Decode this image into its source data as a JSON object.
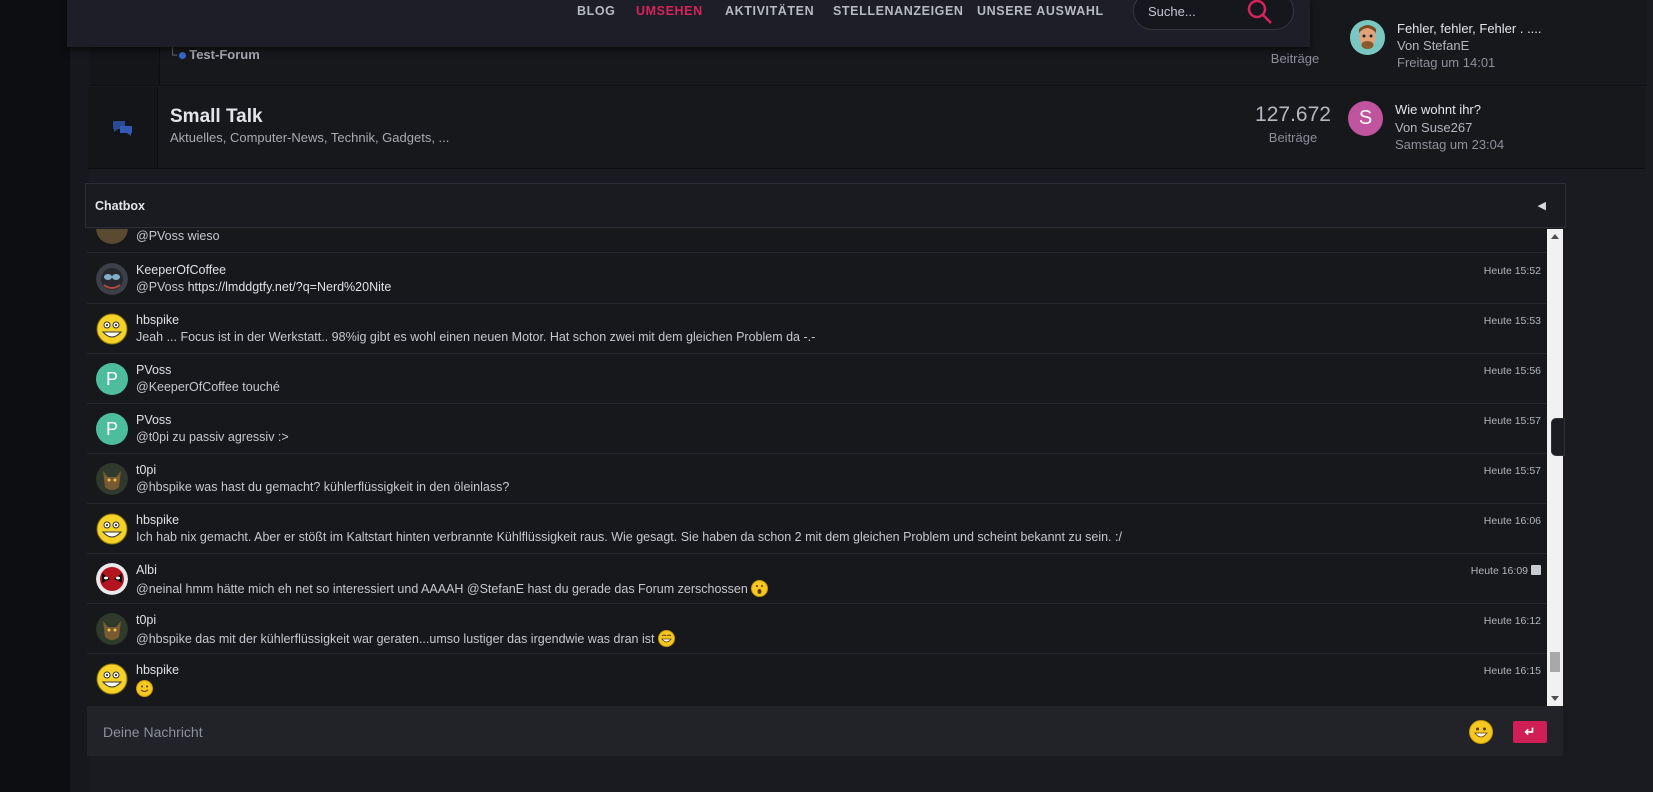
{
  "nav": {
    "items": [
      "BLOG",
      "UMSEHEN",
      "AKTIVITÄTEN",
      "STELLENANZEIGEN",
      "UNSERE AUSWAHL"
    ],
    "active": "UMSEHEN",
    "search_placeholder": "Suche..."
  },
  "forums": [
    {
      "sub_link": "Test-Forum",
      "count_label": "Beiträge",
      "last_post": {
        "title": "Fehler, fehler, Fehler . ....",
        "by": "Von StefanE",
        "date": "Freitag um 14:01"
      }
    },
    {
      "title": "Small Talk",
      "description": "Aktuelles, Computer-News, Technik, Gadgets, ...",
      "count": "127.672",
      "count_label": "Beiträge",
      "last_post": {
        "avatar_letter": "S",
        "title": "Wie wohnt ihr?",
        "by": "Von Suse267",
        "date": "Samstag um 23:04"
      }
    }
  ],
  "chatbox": {
    "title": "Chatbox",
    "partial_message": "@PVoss wieso",
    "messages": [
      {
        "user": "KeeperOfCoffee",
        "text_prefix": "@PVoss ",
        "link": "https://lmddgtfy.net/?q=Nerd%20Nite",
        "time": "Heute 15:52",
        "avatar": "coffee"
      },
      {
        "user": "hbspike",
        "text": "Jeah ... Focus ist in der Werkstatt.. 98%ig gibt es wohl einen neuen Motor. Hat schon zwei mit dem gleichen Problem da -.-",
        "time": "Heute 15:53",
        "avatar": "smiley"
      },
      {
        "user": "PVoss",
        "text": "@KeeperOfCoffee touché",
        "time": "Heute 15:56",
        "avatar": "letter",
        "letter": "P"
      },
      {
        "user": "PVoss",
        "text": "@t0pi zu passiv agressiv :>",
        "time": "Heute 15:57",
        "avatar": "letter",
        "letter": "P"
      },
      {
        "user": "t0pi",
        "text": "@hbspike was hast du gemacht? kühlerflüssigkeit in den öleinlass?",
        "time": "Heute 15:57",
        "avatar": "wolf"
      },
      {
        "user": "hbspike",
        "text": "Ich hab nix gemacht. Aber er stößt im Kaltstart hinten verbrannte Kühlflüssigkeit raus. Wie gesagt. Sie haben da schon 2 mit dem gleichen Problem und scheint bekannt zu sein. :/",
        "time": "Heute 16:06",
        "avatar": "smiley"
      },
      {
        "user": "Albi",
        "text": "@neinal hmm hätte mich eh net so interessiert und AAAAH @StefanE hast du gerade das Forum zerschossen",
        "time": "Heute 16:09",
        "avatar": "deadpool",
        "edited": true,
        "emoji": "surprised"
      },
      {
        "user": "t0pi",
        "text": "@hbspike das mit der kühlerflüssigkeit war geraten...umso lustiger das irgendwie was dran ist",
        "time": "Heute 16:12",
        "avatar": "wolf",
        "emoji": "grin"
      },
      {
        "user": "hbspike",
        "text": "",
        "time": "Heute 16:15",
        "avatar": "smiley",
        "emoji": "smile"
      }
    ],
    "compose_placeholder": "Deine Nachricht",
    "send_label": "↵"
  },
  "colors": {
    "accent": "#cf1f56",
    "nav_active": "#d4245a",
    "background": "#1a1b21"
  }
}
